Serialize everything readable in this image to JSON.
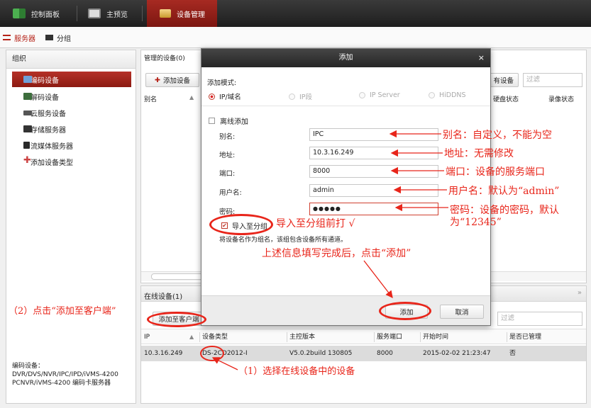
{
  "topbar": {
    "tabs": [
      {
        "label": "控制面板",
        "icon": "dashboard-icon"
      },
      {
        "label": "主预览",
        "icon": "preview-icon"
      },
      {
        "label": "设备管理",
        "icon": "device-management-icon",
        "active": true
      }
    ]
  },
  "subbar": {
    "tabs": [
      {
        "label": "服务器",
        "icon": "server-list-icon",
        "active": true
      },
      {
        "label": "分组",
        "icon": "group-icon"
      }
    ]
  },
  "sidebar": {
    "header": "组织",
    "items": [
      {
        "label": "编码设备",
        "icon": "encoder-icon",
        "selected": true
      },
      {
        "label": "解码设备",
        "icon": "decoder-icon"
      },
      {
        "label": "云服务设备",
        "icon": "cloud-device-icon"
      },
      {
        "label": "存储服务器",
        "icon": "storage-server-icon"
      },
      {
        "label": "流媒体服务器",
        "icon": "stream-server-icon"
      },
      {
        "label": "添加设备类型",
        "icon": "plus-icon"
      }
    ],
    "note": {
      "line1": "编码设备：",
      "line2": "DVR/DVS/NVR/IPC/IPD/iVMS-4200",
      "line3": "PCNVR/iVMS-4200 编码卡服务器"
    }
  },
  "managed": {
    "title": "管理的设备(0)",
    "add_button": "添加设备",
    "partial_button": "有设备",
    "filter_placeholder": "过滤",
    "columns": [
      "别名",
      "硬盘状态",
      "录像状态"
    ]
  },
  "online": {
    "title": "在线设备(1)",
    "add_client_button": "添加至客户端",
    "filter_placeholder": "过滤",
    "columns": [
      "IP",
      "设备类型",
      "主控版本",
      "服务端口",
      "开始时间",
      "是否已管理"
    ],
    "rows": [
      [
        "10.3.16.249",
        "DS-2CD2012-I",
        "V5.0.2build 130805",
        "8000",
        "2015-02-02 21:23:47",
        "否"
      ]
    ]
  },
  "dialog": {
    "title": "添加",
    "close": "×",
    "mode_label": "添加模式:",
    "modes": [
      "IP/域名",
      "IP段",
      "IP Server",
      "HiDDNS"
    ],
    "offline_label": "离线添加",
    "fields": [
      {
        "label": "别名:",
        "value": "IPC"
      },
      {
        "label": "地址:",
        "value": "10.3.16.249"
      },
      {
        "label": "端口:",
        "value": "8000"
      },
      {
        "label": "用户名:",
        "value": "admin"
      },
      {
        "label": "密码:",
        "value": "●●●●●"
      }
    ],
    "import_label": "导入至分组",
    "import_note": "将设备名作为组名，该组包含设备所有通道。",
    "add_button": "添加",
    "cancel_button": "取消"
  },
  "annotations": {
    "alias": "别名：自定义，不能为空",
    "address": "地址：无需修改",
    "port": "端口：设备的服务端口",
    "username": "用户名：默认为“admin”",
    "password_1": "密码：设备的密码，默认",
    "password_2": "为“12345”",
    "import": "导入至分组前打 √",
    "fill_done": "上述信息填写完成后，点击“添加”",
    "step2": "（2）点击“添加至客户端”",
    "step1": "（1）选择在线设备中的设备"
  },
  "colors": {
    "accent": "#b52218",
    "annotation": "#e8251a"
  }
}
